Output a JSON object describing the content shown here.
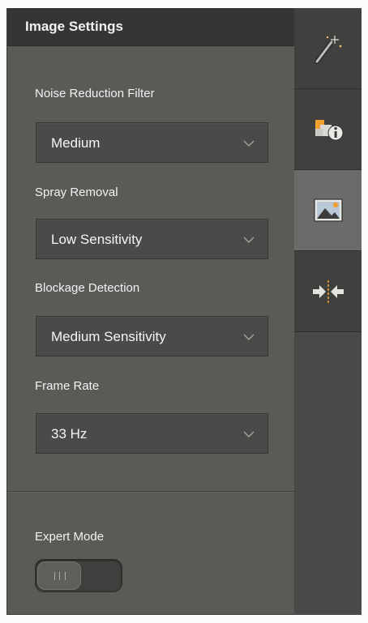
{
  "panel": {
    "title": "Image Settings"
  },
  "settings": [
    {
      "label": "Noise Reduction Filter",
      "value": "Medium"
    },
    {
      "label": "Spray Removal",
      "value": "Low Sensitivity"
    },
    {
      "label": "Blockage Detection",
      "value": "Medium Sensitivity"
    },
    {
      "label": "Frame Rate",
      "value": "33 Hz"
    }
  ],
  "expert_mode": {
    "label": "Expert Mode",
    "enabled": false
  },
  "tabs": [
    {
      "icon": "wand-icon",
      "active": false
    },
    {
      "icon": "info-icon",
      "active": false
    },
    {
      "icon": "image-icon",
      "active": true
    },
    {
      "icon": "alignment-arrows-icon",
      "active": false
    }
  ],
  "colors": {
    "panel_bg": "#595b57",
    "header_bg": "#353633",
    "tab_bg": "#40413e",
    "tab_active_bg": "#6b6c69",
    "accent_orange": "#f0a030"
  }
}
